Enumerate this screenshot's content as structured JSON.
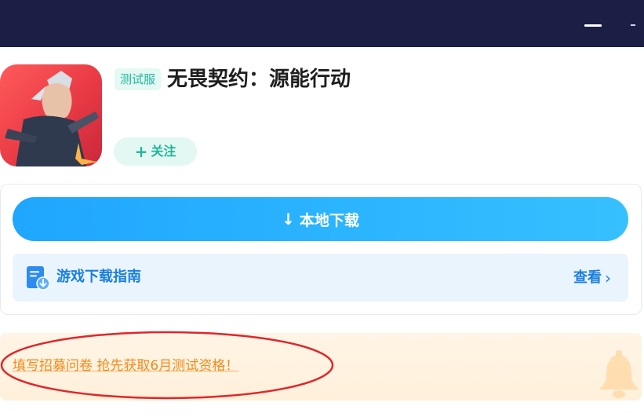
{
  "window": {
    "minimize_icon": "minimize-icon"
  },
  "app": {
    "badge": "测试服",
    "title": "无畏契约：源能行动",
    "follow_label": "关注",
    "follow_icon": "plus-icon"
  },
  "download": {
    "label": "本地下载",
    "icon": "download-arrow-icon"
  },
  "guide": {
    "label": "游戏下载指南",
    "link_label": "查看",
    "icon": "download-guide-icon",
    "chevron_icon": "chevron-right-icon"
  },
  "promo": {
    "text": "填写招募问卷 抢先获取6月测试资格！",
    "icon": "bell-icon"
  },
  "colors": {
    "topbar": "#1b1f45",
    "accent_blue": "#1fa6ff",
    "teal": "#20b79c",
    "promo_orange": "#f28a18",
    "annotation_red": "#e0262b"
  }
}
